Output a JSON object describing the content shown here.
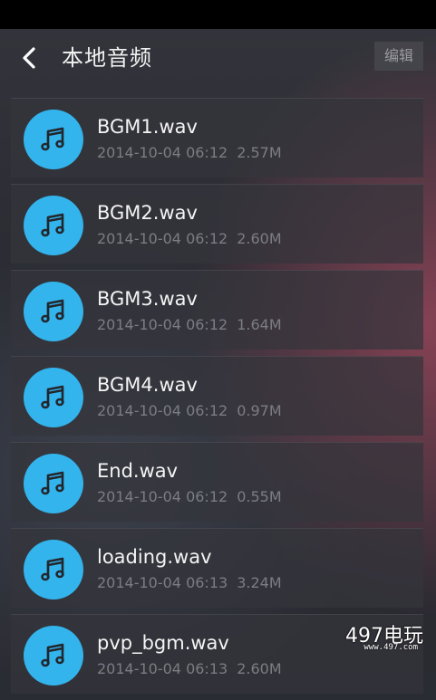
{
  "header": {
    "back_icon": "chevron-left-icon",
    "title": "本地音频",
    "edit_label": "编辑"
  },
  "colors": {
    "accent": "#33b4ec",
    "title": "#f2f2f2",
    "meta": "#7c7d84"
  },
  "files": [
    {
      "name": "BGM1.wav",
      "date": "2014-10-04 06:12",
      "size": "2.57M"
    },
    {
      "name": "BGM2.wav",
      "date": "2014-10-04 06:12",
      "size": "2.60M"
    },
    {
      "name": "BGM3.wav",
      "date": "2014-10-04 06:12",
      "size": "1.64M"
    },
    {
      "name": "BGM4.wav",
      "date": "2014-10-04 06:12",
      "size": "0.97M"
    },
    {
      "name": "End.wav",
      "date": "2014-10-04 06:12",
      "size": "0.55M"
    },
    {
      "name": "loading.wav",
      "date": "2014-10-04 06:13",
      "size": "3.24M"
    },
    {
      "name": "pvp_bgm.wav",
      "date": "2014-10-04 06:13",
      "size": "2.60M"
    }
  ],
  "watermark": {
    "main": "497电玩",
    "sub": "www.497.com"
  }
}
